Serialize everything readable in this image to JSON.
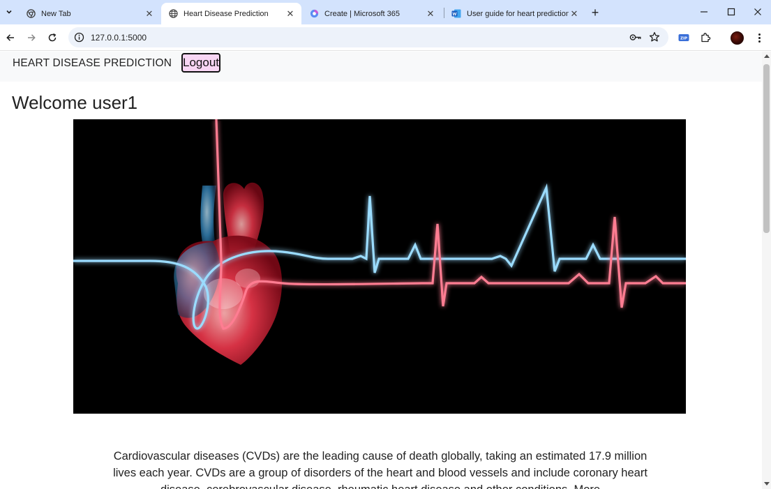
{
  "browser": {
    "tabs": [
      {
        "title": "New Tab",
        "icon": "chrome-icon",
        "active": false
      },
      {
        "title": "Heart Disease Prediction",
        "icon": "globe-icon",
        "active": true
      },
      {
        "title": "Create | Microsoft 365",
        "icon": "microsoft365-icon",
        "active": false
      },
      {
        "title": "User guide for heart prediction",
        "icon": "word-icon",
        "active": false
      }
    ],
    "new_tab_label": "+",
    "url": "127.0.0.1:5000"
  },
  "site": {
    "brand": "HEART DISEASE PREDICTION",
    "logout_label": "Logout",
    "welcome": "Welcome user1",
    "intro": "Cardiovascular diseases (CVDs) are the leading cause of death globally, taking an estimated 17.9 million lives each year. CVDs are a group of disorders of the heart and blood vessels and include coronary heart disease, cerebrovascular disease, rheumatic heart disease and other conditions. More",
    "hero_image": "heart-ecg-illustration"
  },
  "colors": {
    "tabstrip": "#d3e3fd",
    "omnibox": "#edf2fa",
    "logout_bg": "#f8d6f4",
    "ecg_blue": "#8fd8ff",
    "ecg_red": "#ff6f86"
  }
}
